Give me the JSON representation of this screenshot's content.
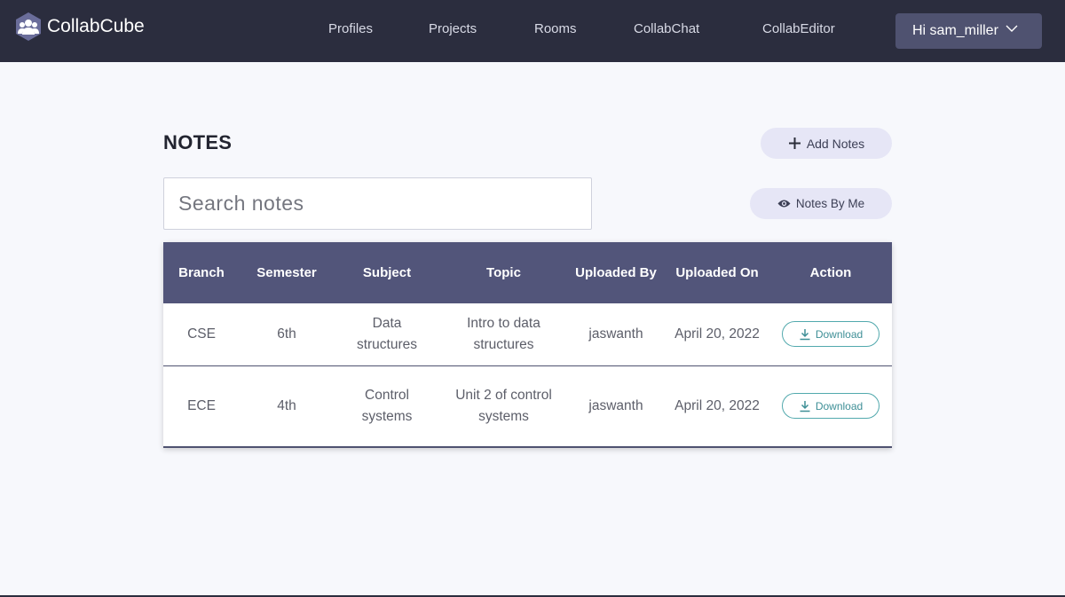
{
  "brand": {
    "name": "CollabCube"
  },
  "nav": {
    "links": [
      "Profiles",
      "Projects",
      "Rooms",
      "CollabChat",
      "CollabEditor"
    ],
    "user_greeting": "Hi sam_miller"
  },
  "main": {
    "title": "NOTES",
    "add_notes_label": "Add Notes",
    "notes_by_me_label": "Notes By Me",
    "search_placeholder": "Search notes"
  },
  "table": {
    "headers": [
      "Branch",
      "Semester",
      "Subject",
      "Topic",
      "Uploaded By",
      "Uploaded On",
      "Action"
    ],
    "rows": [
      {
        "branch": "CSE",
        "semester": "6th",
        "subject": "Data structures",
        "topic": "Intro to data structures",
        "uploaded_by": "jaswanth",
        "uploaded_on": "April 20, 2022",
        "action": "Download"
      },
      {
        "branch": "ECE",
        "semester": "4th",
        "subject": "Control systems",
        "topic": "Unit 2 of control systems",
        "uploaded_by": "jaswanth",
        "uploaded_on": "April 20, 2022",
        "action": "Download"
      }
    ]
  },
  "colors": {
    "navbar": "#2b2d3e",
    "table_header": "#52557a",
    "pill_button": "#e6e6f6",
    "download_accent": "#52a9ad",
    "page_background": "#f7f8fc"
  },
  "icons": {
    "logo": "people-group-icon",
    "user_menu": "chevron-down-icon",
    "add": "plus-icon",
    "notes_by_me": "eye-icon",
    "download": "download-icon"
  }
}
